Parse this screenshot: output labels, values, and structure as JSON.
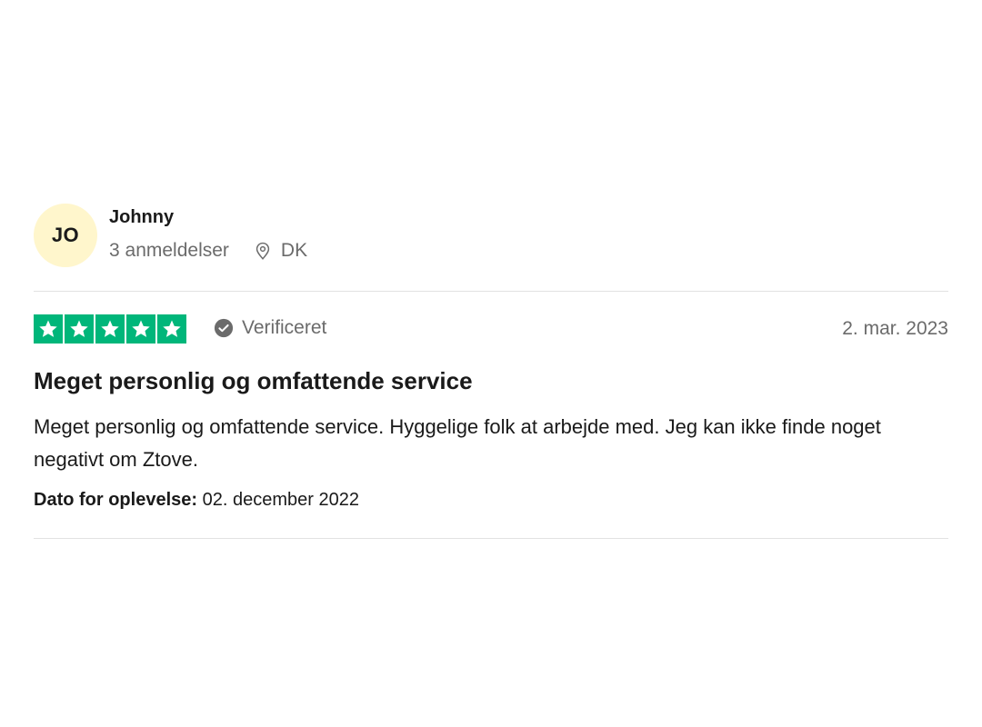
{
  "review": {
    "consumer": {
      "initials": "JO",
      "name": "Johnny",
      "review_count": "3 anmeldelser",
      "location": "DK",
      "avatar_color": "#fff6cc"
    },
    "rating": {
      "stars": 5,
      "max_stars": 5,
      "star_color": "#00b67a"
    },
    "verified_label": "Verificeret",
    "date": "2. mar. 2023",
    "title": "Meget personlig og omfattende service",
    "text": "Meget personlig og omfattende service. Hyggelige folk at arbejde med. Jeg kan ikke finde noget negativt om Ztove.",
    "experience": {
      "label": "Dato for oplevelse:",
      "value": "02. december 2022"
    }
  }
}
